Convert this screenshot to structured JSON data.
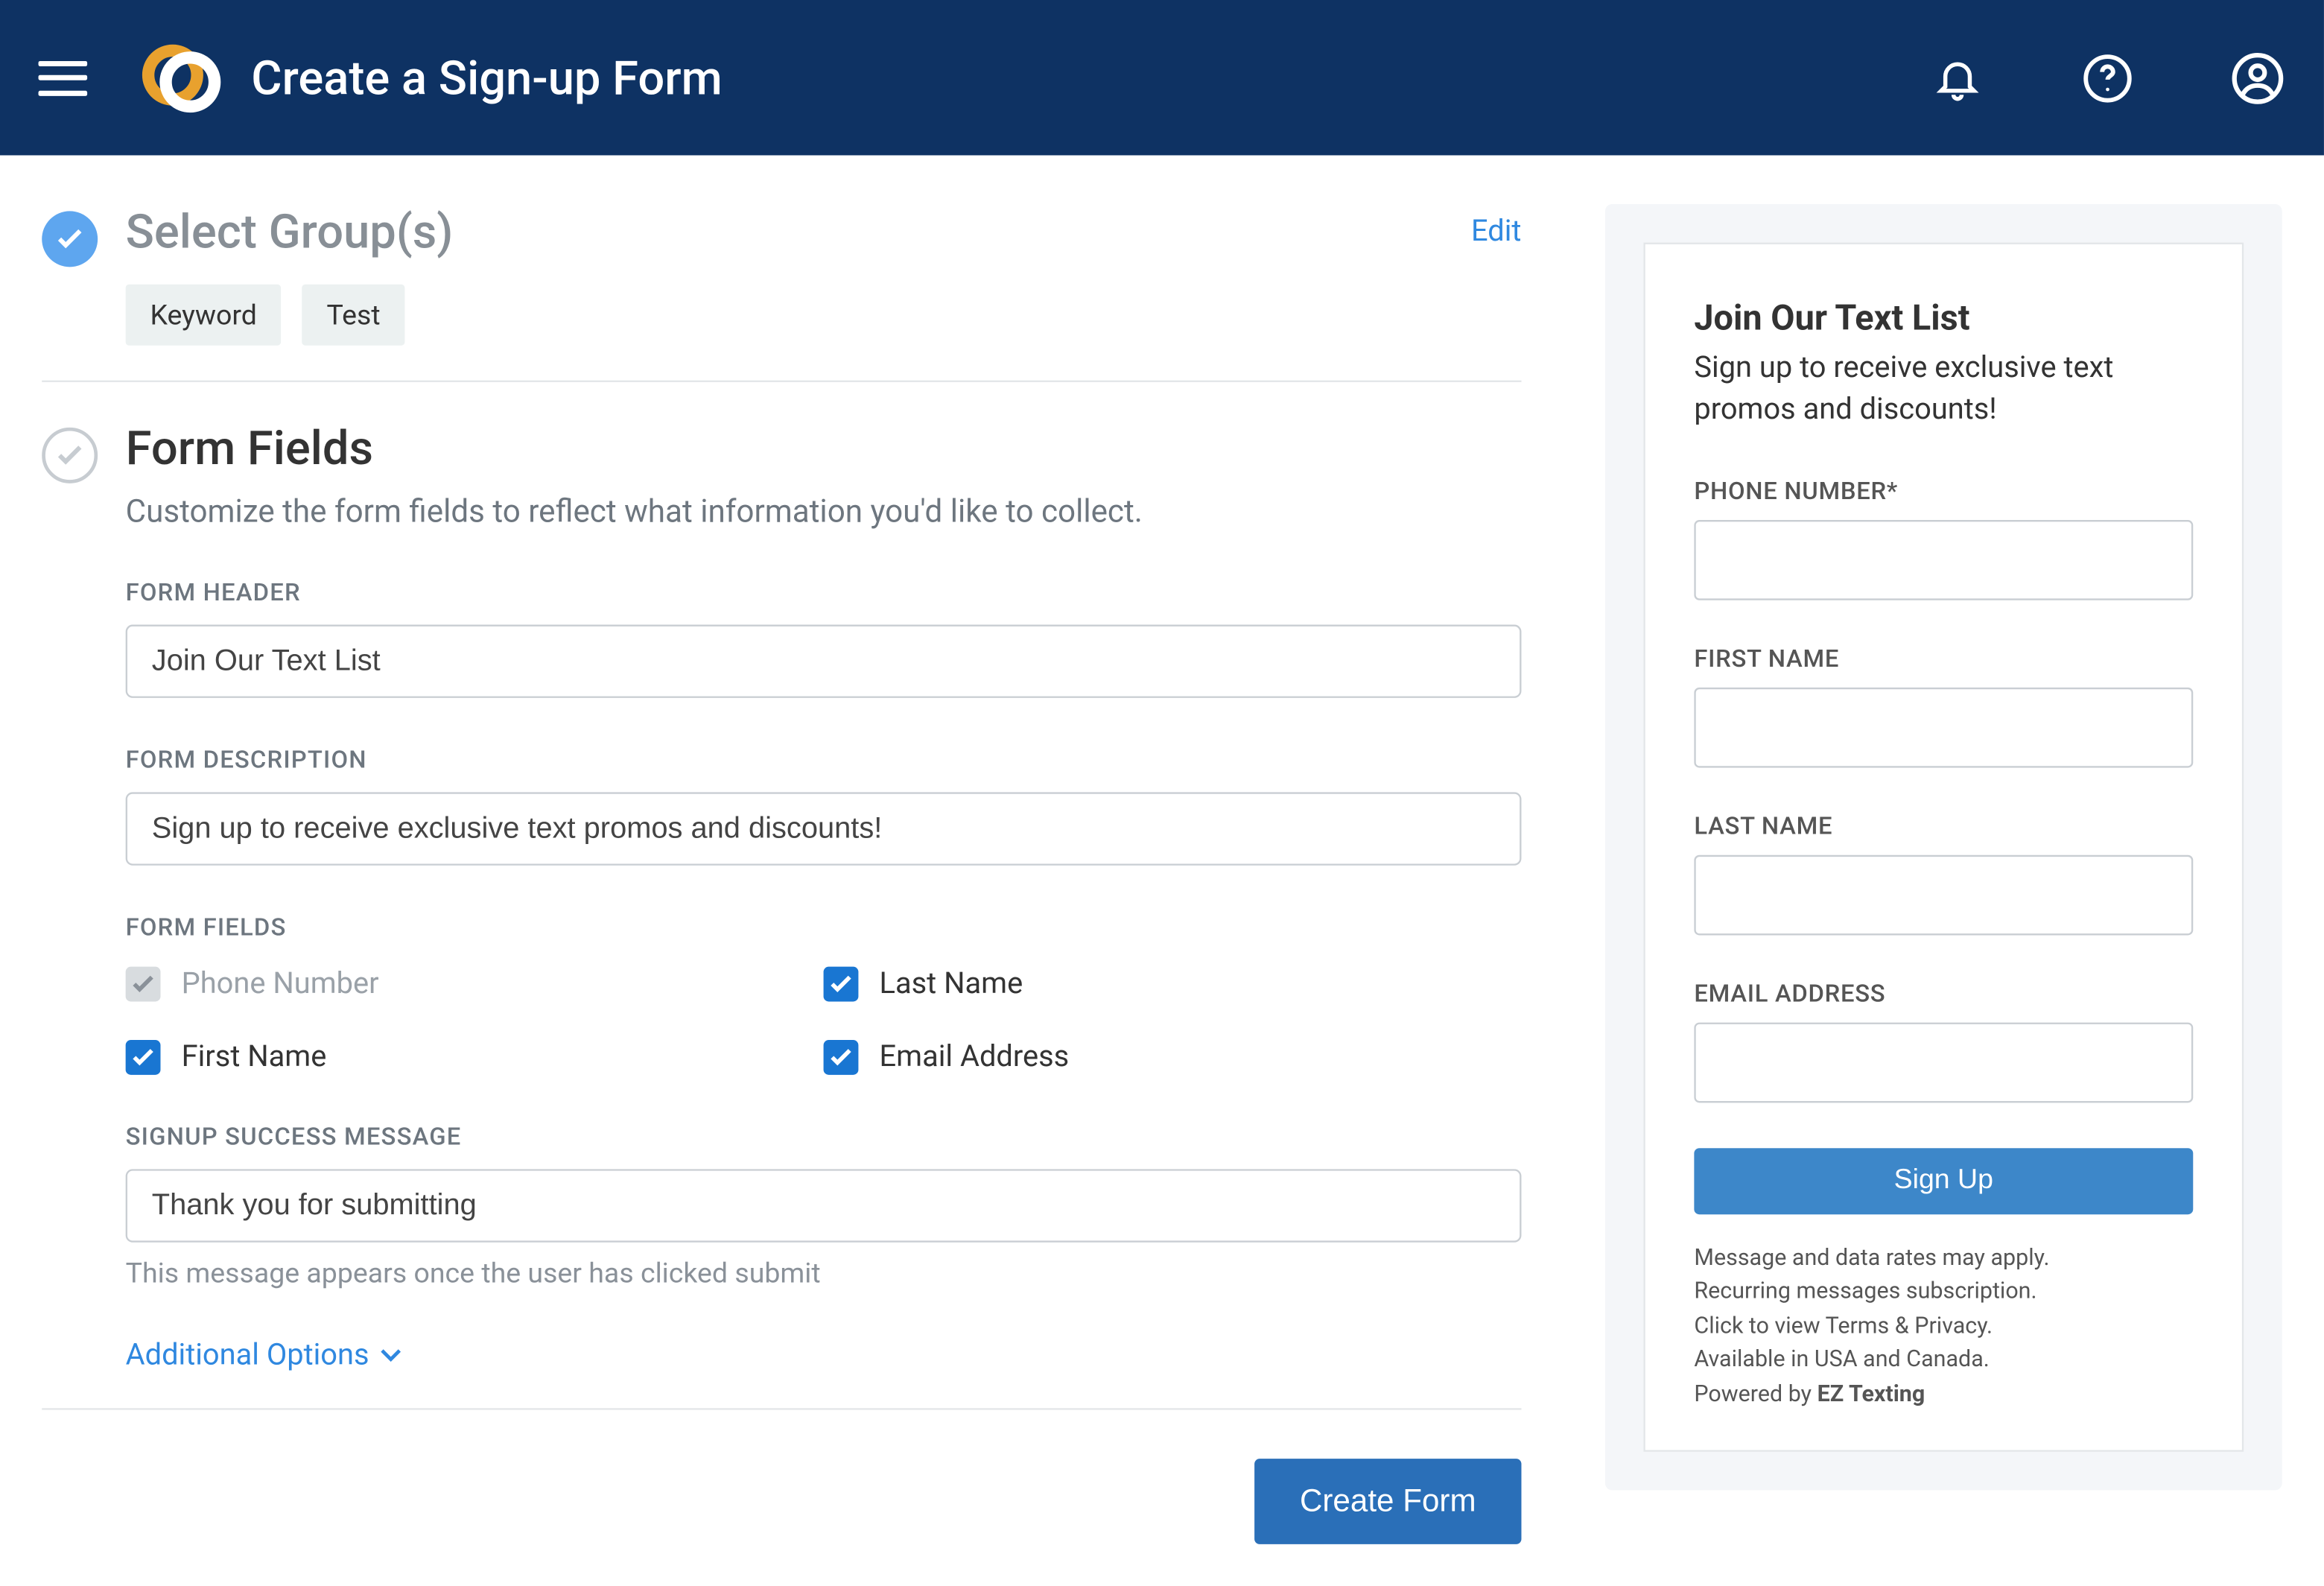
{
  "header": {
    "title": "Create a Sign-up Form"
  },
  "step_groups": {
    "title": "Select Group(s)",
    "edit": "Edit",
    "chips": [
      "Keyword",
      "Test"
    ]
  },
  "step_fields": {
    "title": "Form Fields",
    "subtitle": "Customize the form fields to reflect what information you'd like to collect.",
    "form_header_label": "FORM HEADER",
    "form_header_value": "Join Our Text List",
    "form_desc_label": "FORM DESCRIPTION",
    "form_desc_value": "Sign up to receive exclusive text promos and discounts!",
    "form_fields_label": "FORM FIELDS",
    "checkboxes": [
      {
        "label": "Phone Number",
        "checked": true,
        "disabled": true
      },
      {
        "label": "Last Name",
        "checked": true,
        "disabled": false
      },
      {
        "label": "First Name",
        "checked": true,
        "disabled": false
      },
      {
        "label": "Email Address",
        "checked": true,
        "disabled": false
      }
    ],
    "success_label": "SIGNUP SUCCESS MESSAGE",
    "success_value": "Thank you for submitting",
    "success_helper": "This message appears once the user has clicked submit",
    "additional_options": "Additional Options"
  },
  "actions": {
    "create_form": "Create Form"
  },
  "preview": {
    "title": "Join Our Text List",
    "desc": "Sign up to receive exclusive text promos and discounts!",
    "fields": [
      "PHONE NUMBER*",
      "FIRST NAME",
      "LAST NAME",
      "EMAIL ADDRESS"
    ],
    "signup": "Sign Up",
    "legal_lines": [
      "Message and data rates may apply.",
      "Recurring messages subscription.",
      "Click to view Terms & Privacy.",
      "Available in USA and Canada."
    ],
    "powered_prefix": "Powered by ",
    "powered_brand": "EZ Texting"
  }
}
